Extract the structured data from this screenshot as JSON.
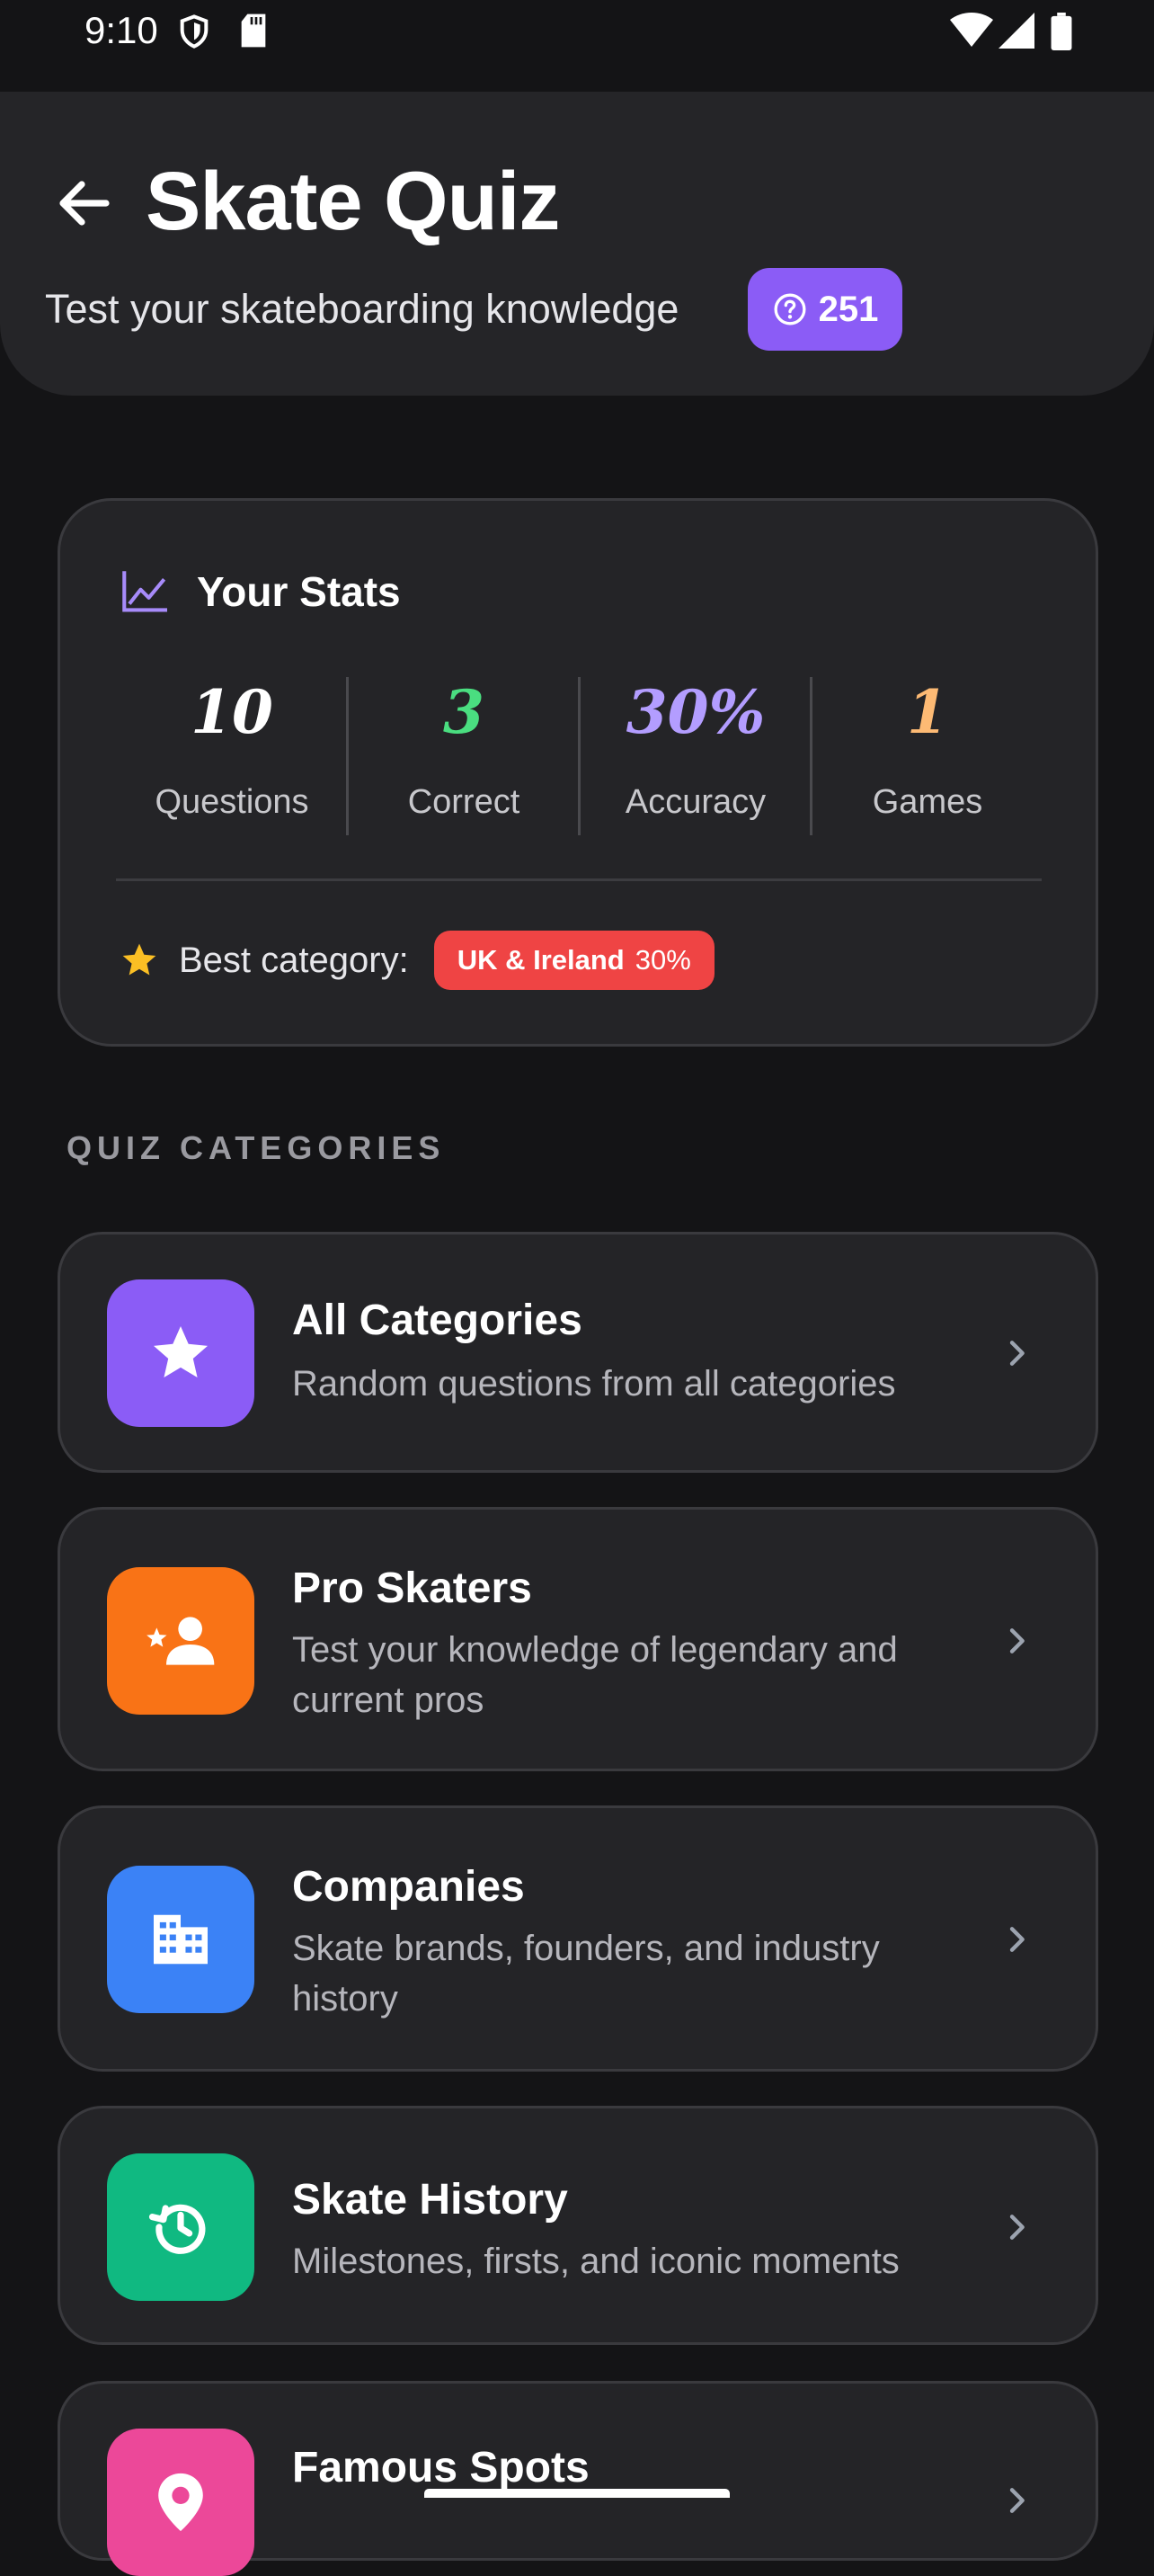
{
  "status_bar": {
    "time": "9:10"
  },
  "header": {
    "title": "Skate Quiz",
    "subtitle": "Test your skateboarding knowledge",
    "question_count": "251"
  },
  "stats": {
    "title": "Your Stats",
    "items": [
      {
        "value": "10",
        "label": "Questions",
        "color": "#ffffff"
      },
      {
        "value": "3",
        "label": "Correct",
        "color": "#4ade80"
      },
      {
        "value": "30%",
        "label": "Accuracy",
        "color": "#b39dff"
      },
      {
        "value": "1",
        "label": "Games",
        "color": "#fdba74"
      }
    ],
    "best_label": "Best category:",
    "best_category": "UK & Ireland",
    "best_percent": "30%"
  },
  "section_title": "QUIZ CATEGORIES",
  "categories": [
    {
      "title": "All Categories",
      "description": "Random questions from all categories",
      "color": "#8b5cf6",
      "icon": "star-icon"
    },
    {
      "title": "Pro Skaters",
      "description": "Test your knowledge of legendary and current pros",
      "color": "#f97316",
      "icon": "person-star-icon"
    },
    {
      "title": "Companies",
      "description": "Skate brands, founders, and industry history",
      "color": "#3b82f6",
      "icon": "building-icon"
    },
    {
      "title": "Skate History",
      "description": "Milestones, firsts, and iconic moments",
      "color": "#10b981",
      "icon": "history-icon"
    },
    {
      "title": "Famous Spots",
      "description": "",
      "color": "#ec4899",
      "icon": "location-pin-icon"
    }
  ]
}
